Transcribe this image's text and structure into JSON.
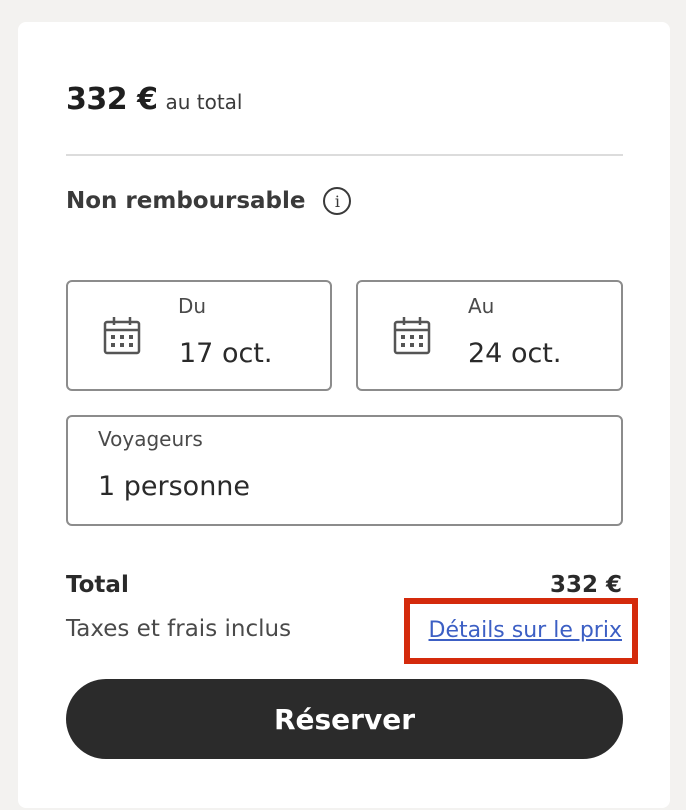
{
  "price": {
    "amount": "332 €",
    "suffix": "au total"
  },
  "rate": {
    "label": "Non remboursable",
    "info_icon": "info-icon"
  },
  "dates": {
    "from": {
      "label": "Du",
      "value": "17 oct.",
      "icon": "calendar-icon"
    },
    "to": {
      "label": "Au",
      "value": "24 oct.",
      "icon": "calendar-icon"
    }
  },
  "travellers": {
    "label": "Voyageurs",
    "value": "1 personne"
  },
  "total": {
    "label": "Total",
    "value": "332 €",
    "taxes_note": "Taxes et frais inclus",
    "details_link": "Détails sur le prix"
  },
  "reserve_button": {
    "label": "Réserver"
  },
  "colors": {
    "highlight": "#d42a0c",
    "link": "#3c5fc4",
    "button_bg": "#2b2b2b",
    "page_bg": "#f3f2f0"
  }
}
